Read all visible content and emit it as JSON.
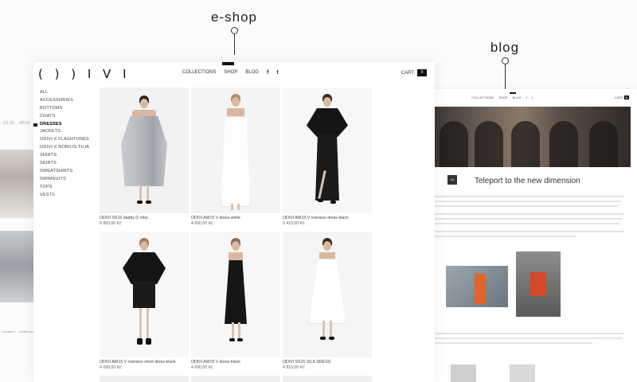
{
  "callouts": {
    "eshop": "e-shop",
    "blog": "blog"
  },
  "background_left": {
    "tag_a": "SS 15",
    "tag_b": "AW14",
    "caption": "...workers / ...cartilla years"
  },
  "blog_mock": {
    "nav": [
      "COLLECTIONS",
      "SHOP",
      "BLOG",
      "f",
      "t"
    ],
    "cart_label": "CART",
    "cart_count": "0",
    "post_title": "Teleport to the new dimension",
    "date_badge": "19"
  },
  "shop": {
    "logo": "( ) ) I V I",
    "nav": {
      "collections": "COLLECTIONS",
      "shop": "SHOP",
      "blog": "BLOG",
      "facebook_icon": "f",
      "twitter_icon": "t"
    },
    "cart_label": "CART",
    "cart_count": "0",
    "sidebar": [
      "ALL",
      "ACCESSORIES",
      "BOTTOMS",
      "COATS",
      "DRESSES",
      "JACKETS",
      "ODIVI X FLASHTONES",
      "ODIVI X NOBILIS TILIA",
      "SHIRTS",
      "SKIRTS",
      "SWEATSHIRTS",
      "SWIMSUITS",
      "TOPS",
      "VESTS"
    ],
    "active_category": "DRESSES",
    "products": [
      {
        "name": "ODIVI SS16 daddy D robe",
        "price": "8 860,00 Kč"
      },
      {
        "name": "ODIVI AW15 V dress white",
        "price": "4 090,00 Kč"
      },
      {
        "name": "ODIVI AW15 V oversize dress black",
        "price": "9 410,00 Kč"
      },
      {
        "name": "ODIVI AW15 V oversize short dress black",
        "price": "4 090,00 Kč"
      },
      {
        "name": "ODIVI AW15 V dress black",
        "price": "4 090,00 Kč"
      },
      {
        "name": "ODIVI SS15 SILK DRESS",
        "price": "4 810,00 Kč"
      }
    ]
  },
  "colors": {
    "accent": "#111111",
    "background": "#fbfbfb"
  }
}
